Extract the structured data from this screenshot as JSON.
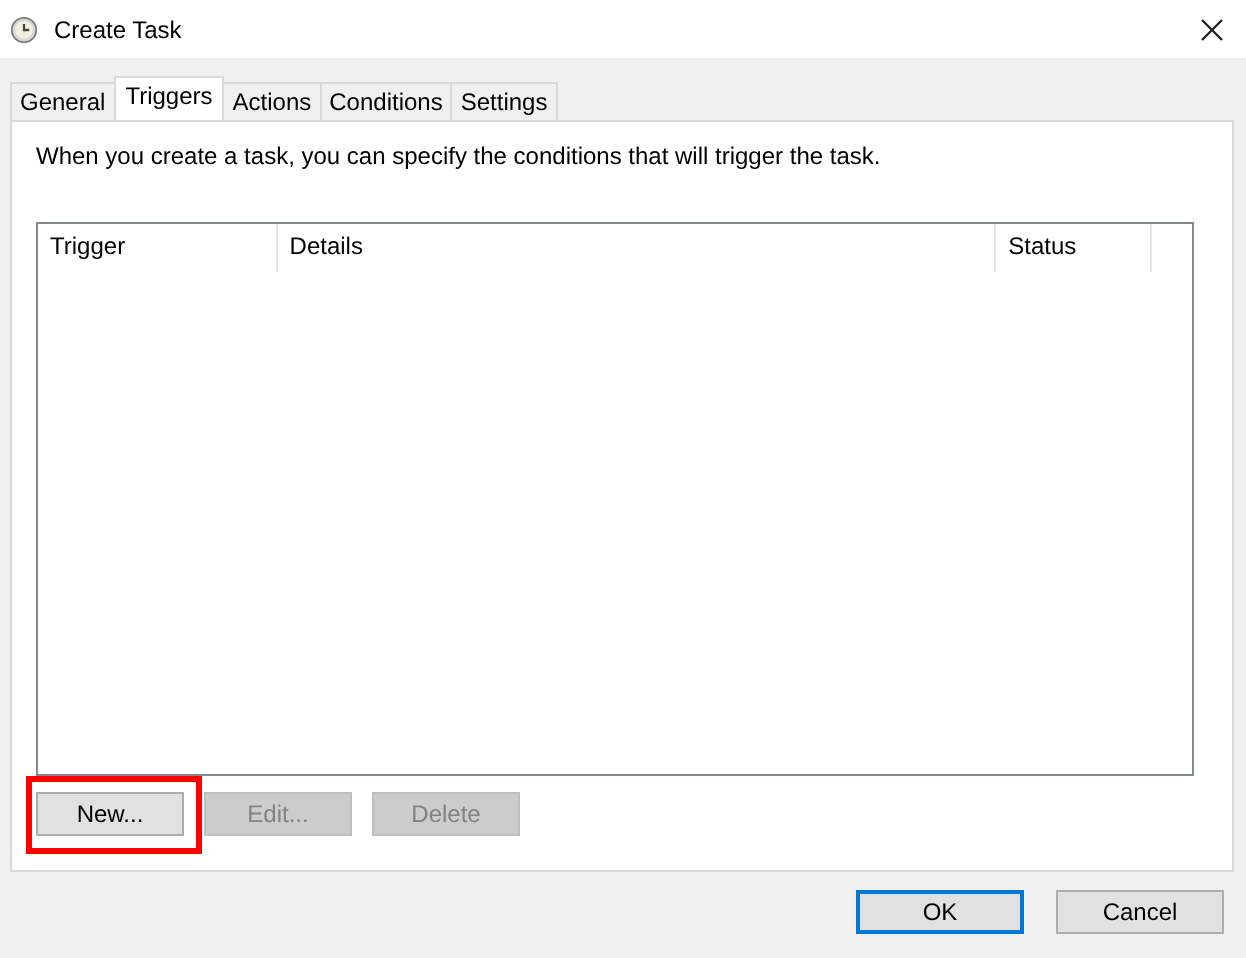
{
  "window": {
    "title": "Create Task"
  },
  "tabs": [
    {
      "label": "General",
      "selected": false
    },
    {
      "label": "Triggers",
      "selected": true
    },
    {
      "label": "Actions",
      "selected": false
    },
    {
      "label": "Conditions",
      "selected": false
    },
    {
      "label": "Settings",
      "selected": false
    }
  ],
  "description": "When you create a task, you can specify the conditions that will trigger the task.",
  "table": {
    "columns": [
      "Trigger",
      "Details",
      "Status"
    ]
  },
  "list_buttons": [
    {
      "label": "New...",
      "disabled": false,
      "highlighted": true
    },
    {
      "label": "Edit...",
      "disabled": true,
      "highlighted": false
    },
    {
      "label": "Delete",
      "disabled": true,
      "highlighted": false
    }
  ],
  "dialog_buttons": [
    {
      "label": "OK",
      "default": true
    },
    {
      "label": "Cancel",
      "default": false
    }
  ]
}
